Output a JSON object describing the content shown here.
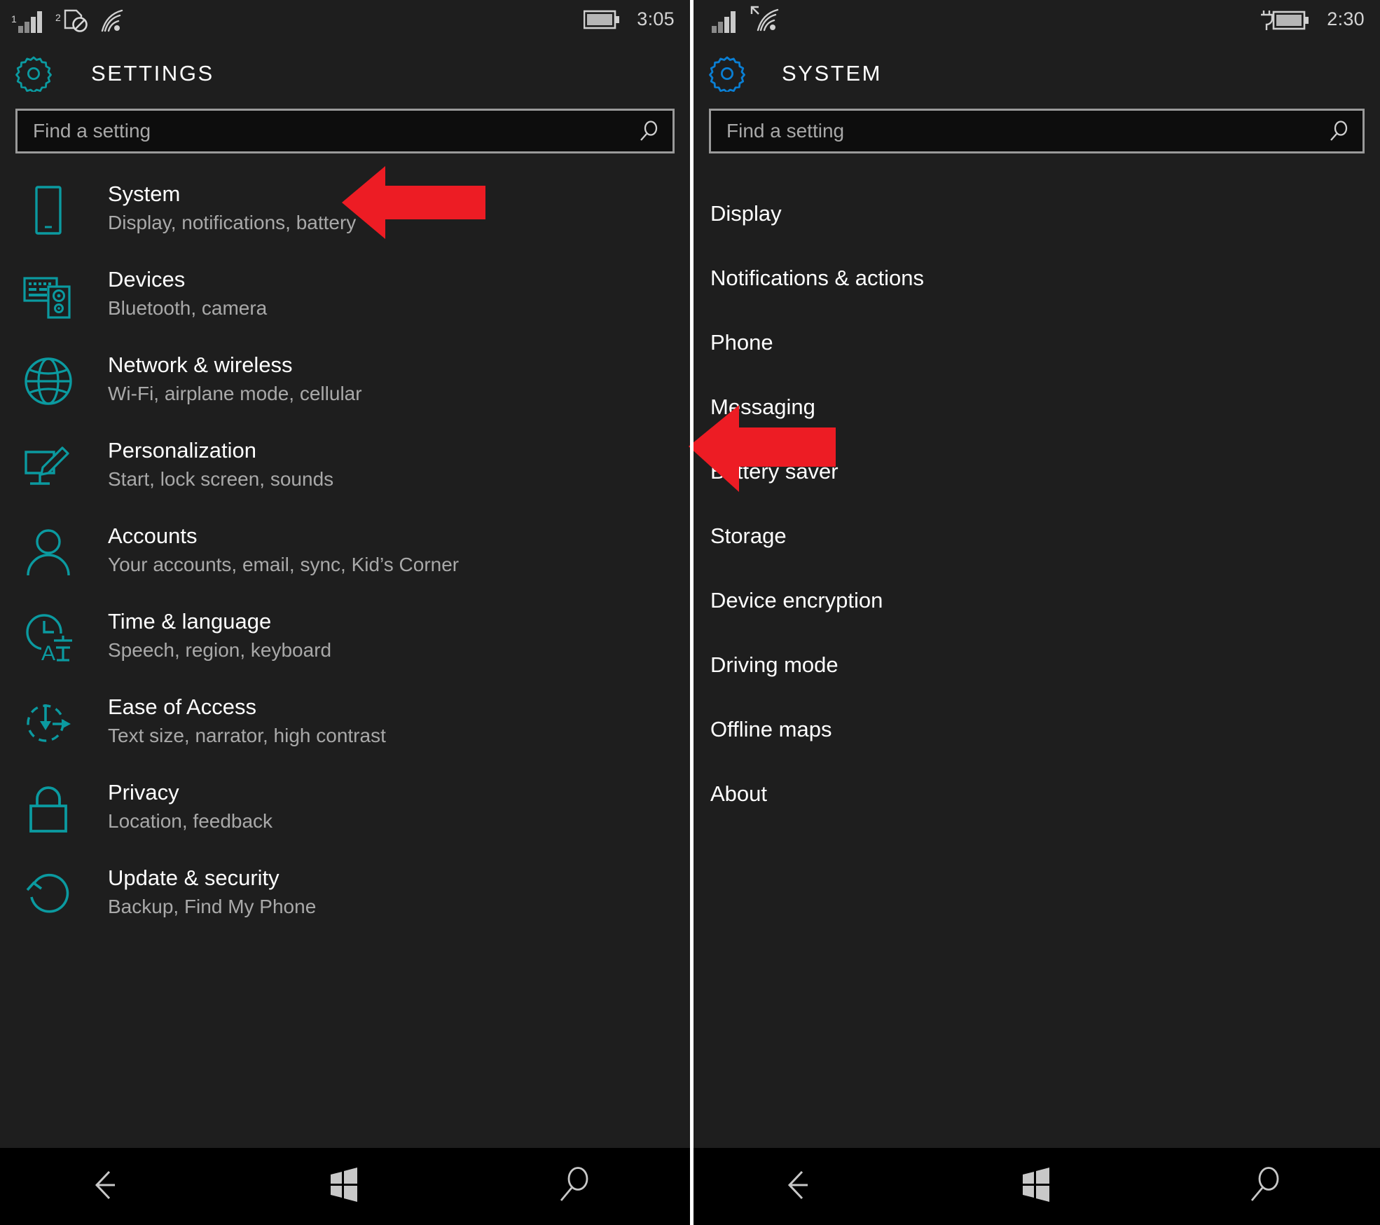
{
  "accent": {
    "teal": "#0b9aa0",
    "blue": "#0a7fd4",
    "arrow_red": "#ed1c24",
    "panel_bg": "#1e1e1e",
    "nav_bg": "#000000"
  },
  "left_phone": {
    "status": {
      "time": "3:05",
      "signal_label": "1",
      "sim2_label": "2",
      "icons": [
        "signal-bars-icon",
        "sim-card-disabled-icon",
        "wifi-icon",
        "battery-icon"
      ]
    },
    "header": {
      "gear_icon": "gear-icon",
      "title": "SETTINGS"
    },
    "search": {
      "placeholder": "Find a setting",
      "value": "",
      "icon": "search-icon"
    },
    "items": [
      {
        "title": "System",
        "subtitle": "Display, notifications, battery",
        "icon": "phone-icon"
      },
      {
        "title": "Devices",
        "subtitle": "Bluetooth, camera",
        "icon": "keyboard-mouse-icon"
      },
      {
        "title": "Network & wireless",
        "subtitle": "Wi-Fi, airplane mode, cellular",
        "icon": "globe-icon"
      },
      {
        "title": "Personalization",
        "subtitle": "Start, lock screen, sounds",
        "icon": "pen-tablet-icon"
      },
      {
        "title": "Accounts",
        "subtitle": "Your accounts, email, sync, Kid’s Corner",
        "icon": "person-icon"
      },
      {
        "title": "Time & language",
        "subtitle": "Speech, region, keyboard",
        "icon": "clock-language-icon"
      },
      {
        "title": "Ease of Access",
        "subtitle": "Text size, narrator, high contrast",
        "icon": "ease-of-access-icon"
      },
      {
        "title": "Privacy",
        "subtitle": "Location, feedback",
        "icon": "lock-icon"
      },
      {
        "title": "Update & security",
        "subtitle": "Backup, Find My Phone",
        "icon": "refresh-icon"
      }
    ],
    "nav": [
      {
        "label": "Back",
        "icon": "back-arrow-icon"
      },
      {
        "label": "Start",
        "icon": "windows-logo-icon"
      },
      {
        "label": "Search",
        "icon": "search-icon"
      }
    ]
  },
  "right_phone": {
    "status": {
      "time": "2:30",
      "icons": [
        "signal-bars-icon",
        "wifi-icon",
        "battery-charging-icon"
      ]
    },
    "header": {
      "gear_icon": "gear-icon",
      "title": "SYSTEM"
    },
    "search": {
      "placeholder": "Find a setting",
      "value": "",
      "icon": "search-icon"
    },
    "items": [
      {
        "title": "Display"
      },
      {
        "title": "Notifications & actions"
      },
      {
        "title": "Phone"
      },
      {
        "title": "Messaging"
      },
      {
        "title": "Battery saver"
      },
      {
        "title": "Storage"
      },
      {
        "title": "Device encryption"
      },
      {
        "title": "Driving mode"
      },
      {
        "title": "Offline maps"
      },
      {
        "title": "About"
      }
    ],
    "nav": [
      {
        "label": "Back",
        "icon": "back-arrow-icon"
      },
      {
        "label": "Start",
        "icon": "windows-logo-icon"
      },
      {
        "label": "Search",
        "icon": "search-icon"
      }
    ]
  },
  "annotations": [
    {
      "name": "arrow-pointing-to-system",
      "points_to": "System",
      "color": "#ed1c24",
      "direction": "left"
    },
    {
      "name": "arrow-pointing-to-battery-saver",
      "points_to": "Battery saver",
      "color": "#ed1c24",
      "direction": "left"
    }
  ]
}
